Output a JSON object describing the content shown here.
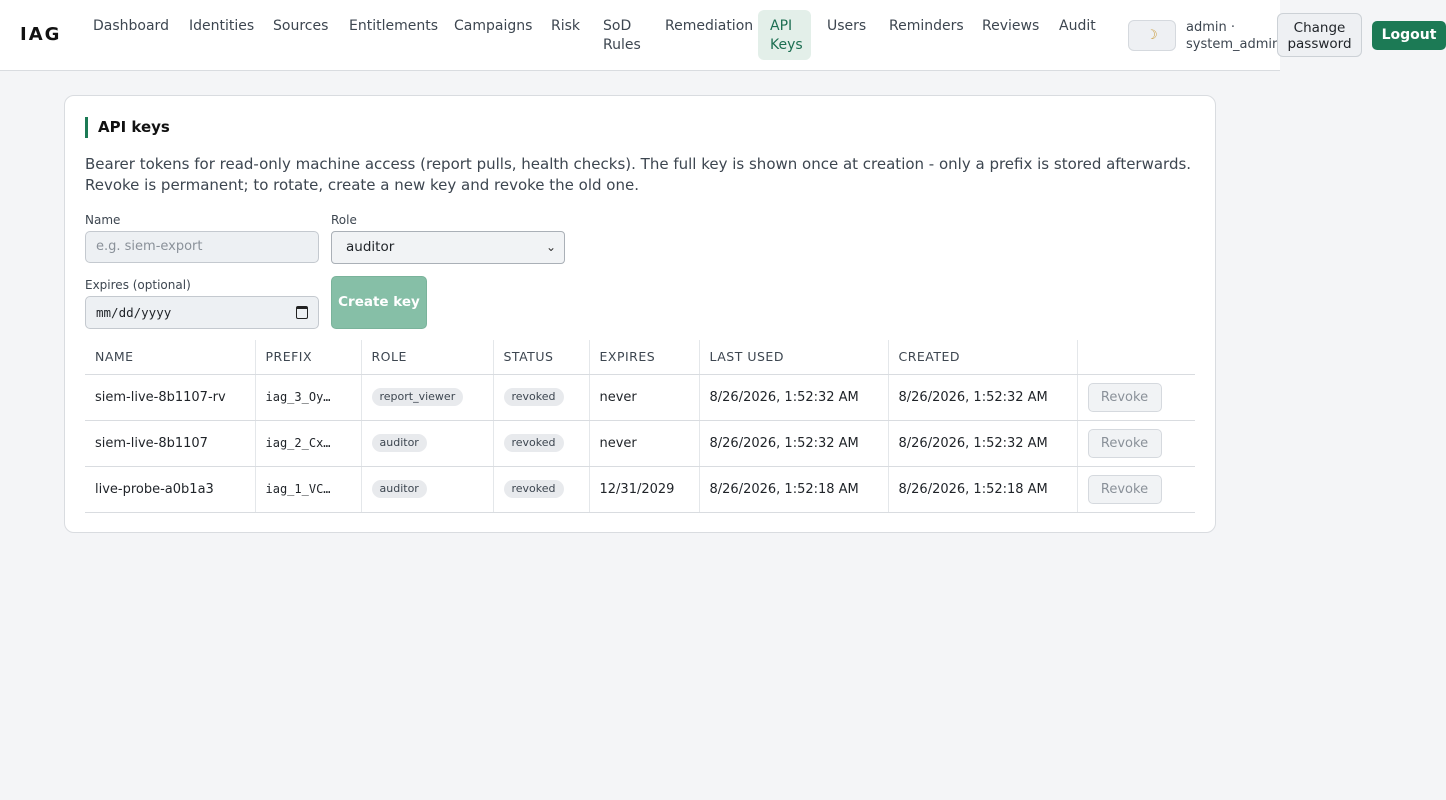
{
  "brand": "IAG",
  "nav": [
    {
      "label": "Dashboard",
      "active": false
    },
    {
      "label": "Identities",
      "active": false
    },
    {
      "label": "Sources",
      "active": false
    },
    {
      "label": "Entitlements",
      "active": false
    },
    {
      "label": "Campaigns",
      "active": false
    },
    {
      "label": "Risk",
      "active": false
    },
    {
      "label": "SoD Rules",
      "active": false
    },
    {
      "label": "Remediation",
      "active": false
    },
    {
      "label": "API Keys",
      "active": true
    },
    {
      "label": "Users",
      "active": false
    },
    {
      "label": "Reminders",
      "active": false
    },
    {
      "label": "Reviews",
      "active": false
    },
    {
      "label": "Audit",
      "active": false
    }
  ],
  "header": {
    "theme_icon": "moon-icon",
    "user": "admin · system_admin",
    "change_password": "Change password",
    "logout": "Logout"
  },
  "page": {
    "title": "API keys",
    "description": "Bearer tokens for read-only machine access (report pulls, health checks). The full key is shown once at creation - only a prefix is stored afterwards. Revoke is permanent; to rotate, create a new key and revoke the old one."
  },
  "form": {
    "name_label": "Name",
    "name_placeholder": "e.g. siem-export",
    "role_label": "Role",
    "role_value": "auditor",
    "expires_label": "Expires (optional)",
    "expires_placeholder": "mm/dd/yyyy",
    "create_label": "Create key"
  },
  "table": {
    "columns": [
      "NAME",
      "PREFIX",
      "ROLE",
      "STATUS",
      "EXPIRES",
      "LAST USED",
      "CREATED",
      ""
    ],
    "rows": [
      {
        "name": "siem-live-8b1107-rv",
        "prefix": "iag_3_Oy…",
        "role": "report_viewer",
        "status": "revoked",
        "expires": "never",
        "last_used": "8/26/2026, 1:52:32 AM",
        "created": "8/26/2026, 1:52:32 AM",
        "action": "Revoke"
      },
      {
        "name": "siem-live-8b1107",
        "prefix": "iag_2_Cx…",
        "role": "auditor",
        "status": "revoked",
        "expires": "never",
        "last_used": "8/26/2026, 1:52:32 AM",
        "created": "8/26/2026, 1:52:32 AM",
        "action": "Revoke"
      },
      {
        "name": "live-probe-a0b1a3",
        "prefix": "iag_1_VC…",
        "role": "auditor",
        "status": "revoked",
        "expires": "12/31/2029",
        "last_used": "8/26/2026, 1:52:18 AM",
        "created": "8/26/2026, 1:52:18 AM",
        "action": "Revoke"
      }
    ]
  }
}
